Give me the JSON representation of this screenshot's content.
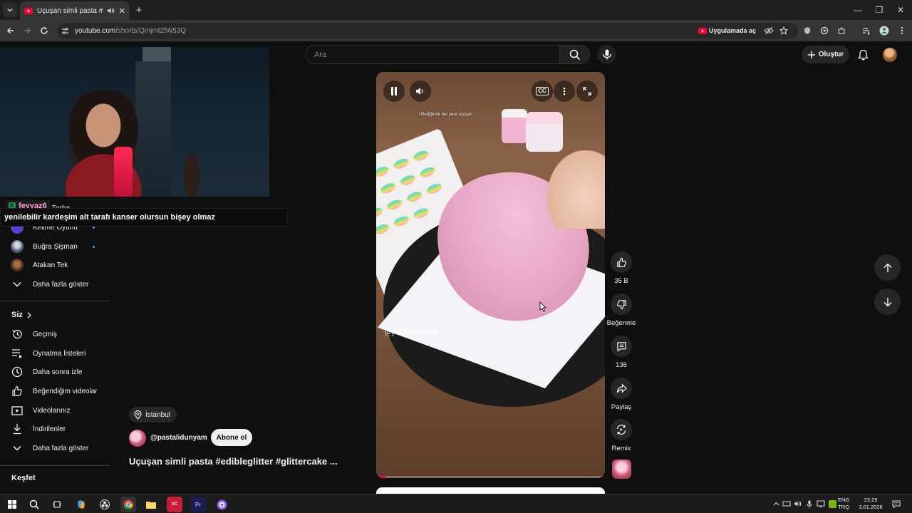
{
  "browser": {
    "tab_title": "Uçuşan simli pasta #edible",
    "url_host": "youtube.com",
    "url_path": "/shorts/Qmjmt2fW53Q",
    "open_in_app_label": "Uygulamada aç"
  },
  "header": {
    "search_placeholder": "Ara",
    "create_label": "Oluştur"
  },
  "stream_overlay": {
    "chat_user": "feyyaz6",
    "chat_behind_text": "Zorba",
    "chat_message": "yenilebilir kardeşim alt tarafı kanser olursun bişey olmaz"
  },
  "sidebar": {
    "subscriptions": [
      {
        "label": "Kelime Oyunu",
        "new": true,
        "avatar_color": "#5b3fd1"
      },
      {
        "label": "Buğra Şişman",
        "new": true,
        "avatar_color": "#4a5a6a"
      },
      {
        "label": "Atakan Tek",
        "new": false,
        "avatar_color": "#3a2a22"
      }
    ],
    "show_more_1": "Daha fazla göster",
    "section_you": "Siz",
    "you_items": [
      {
        "label": "Geçmiş",
        "icon": "history-icon"
      },
      {
        "label": "Oynatma listeleri",
        "icon": "playlist-icon"
      },
      {
        "label": "Daha sonra izle",
        "icon": "watch-later-icon"
      },
      {
        "label": "Beğendiğim videolar",
        "icon": "liked-icon"
      },
      {
        "label": "Videolarınız",
        "icon": "your-videos-icon"
      },
      {
        "label": "İndirilenler",
        "icon": "download-icon"
      }
    ],
    "show_more_2": "Daha fazla göster",
    "section_explore": "Keşfet"
  },
  "short": {
    "location": "İstanbul",
    "channel": "@pastalidunyam",
    "subscribe_label": "Abone ol",
    "title": "Uçuşan simli pasta #edibleglitter #glittercake ...",
    "caption_top": "Üflediğinde her yere uçuşan",
    "watermark": "@pastalidunyam",
    "progress": 0.04,
    "cc_label": "CC"
  },
  "actions": {
    "likes": "35 B",
    "dislike_label": "Beğenme",
    "comments": "136",
    "share_label": "Paylaş",
    "remix_label": "Remix"
  },
  "taskbar": {
    "lang_top": "ENG",
    "lang_bottom": "TRQ",
    "time": "23:29",
    "date": "3.01.2026"
  }
}
